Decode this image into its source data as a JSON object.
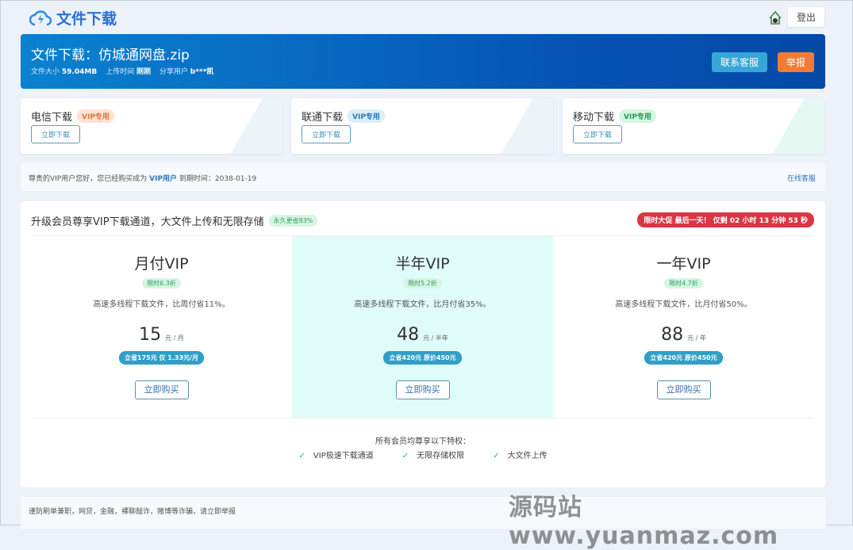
{
  "header": {
    "logo_text": "文件下载",
    "logout_label": "登出"
  },
  "banner": {
    "title": "文件下载：仿城通网盘.zip",
    "size_label": "文件大小",
    "size_value": "59.04MB",
    "upload_label": "上传时间",
    "upload_value": "刚刚",
    "sharer_label": "分享用户",
    "sharer_value": "b***凯",
    "contact_label": "联系客服",
    "report_label": "举报"
  },
  "downloads": [
    {
      "name": "电信下载",
      "tag": "VIP专用",
      "button": "立即下载",
      "tag_color": "#e8743b",
      "tag_bg": "#fde3d3"
    },
    {
      "name": "联通下载",
      "tag": "VIP专用",
      "button": "立即下载",
      "tag_color": "#2a7ac4",
      "tag_bg": "#dceef9"
    },
    {
      "name": "移动下载",
      "tag": "VIP专用",
      "button": "立即下载",
      "tag_color": "#1e9e55",
      "tag_bg": "#d6f5e2"
    }
  ],
  "notice": {
    "prefix": "尊贵的VIP用户您好，您已经购买成为",
    "vip": "VIP用户",
    "expiry": "到期时间：2038-01-19",
    "service": "在线客服"
  },
  "pricing": {
    "title": "升级会员尊享VIP下载通道，大文件上传和无限存储",
    "title_badge": "永久更省83%",
    "timer": "限时大促 最后一天！ 仅剩 02 小时 13 分钟 53 秒",
    "plans": [
      {
        "name": "月付VIP",
        "discount": "限时6.3折",
        "desc": "高速多线程下载文件，比周付省11%。",
        "price": "15",
        "unit": "元 / 月",
        "save": "立省175元 仅 1.33元/月",
        "buy": "立即购买"
      },
      {
        "name": "半年VIP",
        "discount": "限时5.2折",
        "desc": "高速多线程下载文件，比月付省35%。",
        "price": "48",
        "unit": "元 / 半年",
        "save": "立省420元 原价450元",
        "buy": "立即购买"
      },
      {
        "name": "一年VIP",
        "discount": "限时4.7折",
        "desc": "高速多线程下载文件，比月付省50%。",
        "price": "88",
        "unit": "元 / 年",
        "save": "立省420元 原价450元",
        "buy": "立即购买"
      }
    ],
    "privileges_title": "所有会员均尊享以下特权：",
    "privileges": [
      "VIP极速下载通道",
      "无限存储权限",
      "大文件上传"
    ]
  },
  "footer": {
    "warning": "谨防刷单兼职，网贷，金融，裸聊敲诈，赌博等诈骗，请立即举报"
  },
  "watermark": "源码站www.yuanmaz.com"
}
